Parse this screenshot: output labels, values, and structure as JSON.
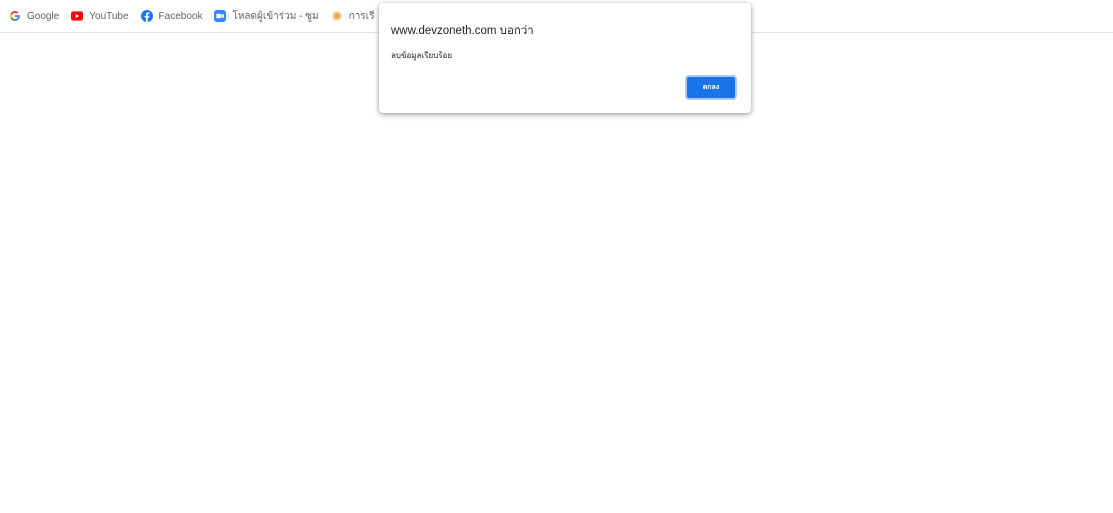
{
  "bookmarks": [
    {
      "label": "Google",
      "icon": "google-icon"
    },
    {
      "label": "YouTube",
      "icon": "youtube-icon"
    },
    {
      "label": "Facebook",
      "icon": "facebook-icon"
    },
    {
      "label": "โหลดผู้เข้าร่วม - ซูม",
      "icon": "zoom-icon"
    },
    {
      "label": "การเรี",
      "icon": "bookmark-icon"
    }
  ],
  "dialog": {
    "title": "www.devzoneth.com บอกว่า",
    "message": "ลบข้อมูลเรียบร้อย",
    "ok_label": "ตกลง"
  },
  "colors": {
    "accent": "#1a73e8",
    "youtube": "#ff0000",
    "facebook": "#1877f2",
    "zoom": "#2d8cff"
  }
}
